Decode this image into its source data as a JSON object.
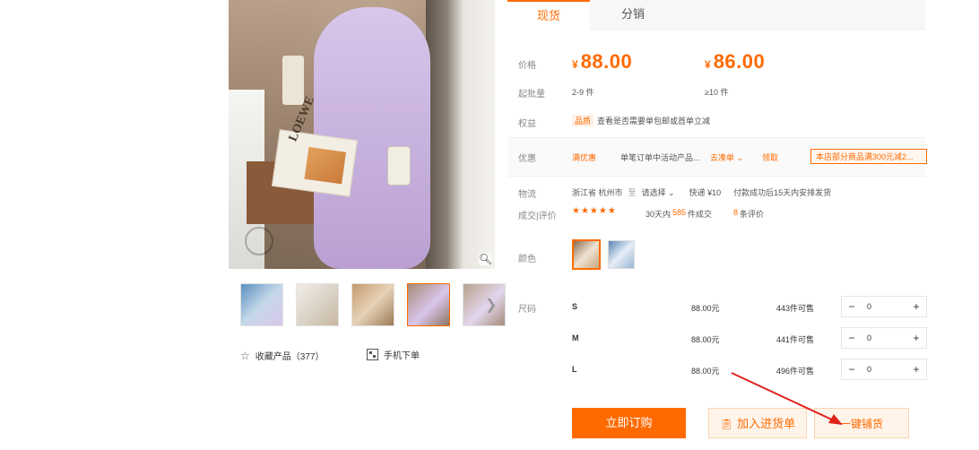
{
  "tabs": [
    {
      "label": "现货"
    },
    {
      "label": "分销"
    }
  ],
  "pricing": {
    "price_label": "价格",
    "currency": "¥",
    "tiers": [
      {
        "price": "88.00",
        "qty": "2-9 件"
      },
      {
        "price": "86.00",
        "qty": "≥10 件"
      }
    ],
    "moq_label": "起批量"
  },
  "service": {
    "label": "权益",
    "badge": "品质",
    "text": "查看是否需要单包邮或首单立减"
  },
  "promo": {
    "label": "优惠",
    "coupon_tag": "满优惠",
    "desc": "单笔订单中活动产品...",
    "more": "去凑单",
    "voucher_tag": "领取",
    "pill": "本店部分商品满300元减2..."
  },
  "shipping": {
    "label": "物流",
    "from": "浙江省 杭州市",
    "to_prefix": "至",
    "to": "请选择",
    "fee": "快递 ¥10",
    "note": "付款成功后15天内安排发货"
  },
  "reviews": {
    "label": "成交|评价",
    "stars": "★★★★★",
    "deals_prefix": "30天内",
    "deals_count": "585",
    "deals_suffix": "件成交",
    "review_count": "8",
    "review_suffix": "条评价"
  },
  "color": {
    "label": "颜色"
  },
  "size_label": "尺码",
  "sizes": [
    {
      "name": "S",
      "price": "88.00元",
      "stock": "443件可售",
      "qty": "0"
    },
    {
      "name": "M",
      "price": "88.00元",
      "stock": "441件可售",
      "qty": "0"
    },
    {
      "name": "L",
      "price": "88.00元",
      "stock": "496件可售",
      "qty": "0"
    }
  ],
  "actions": {
    "order": "立即订购",
    "cart": "加入进货单",
    "one_click": "一键铺货"
  },
  "gallery": {
    "favorite": "收藏产品（377）",
    "mobile_order": "手机下单",
    "magazine_text": "LOEWE"
  },
  "colors": {
    "accent": "#ff6a00"
  }
}
